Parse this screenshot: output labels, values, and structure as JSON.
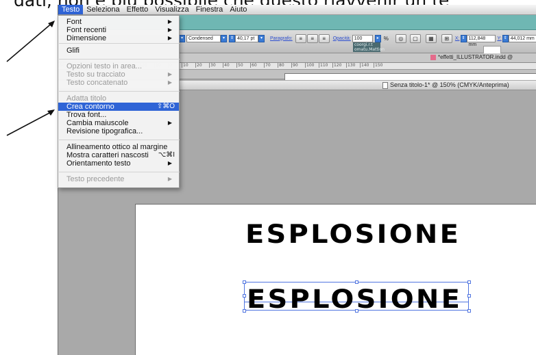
{
  "caption": "dati, non è più possibile che questo riavvenir un te",
  "menubar": {
    "items": [
      "Testo",
      "Seleziona",
      "Effetto",
      "Visualizza",
      "Finestra",
      "Aiuto"
    ],
    "active": "Testo"
  },
  "toolbar": {
    "font_style": "Condensed",
    "font_size": "40,17 pt",
    "paragraph_label": "Paragrafo:",
    "opacity_label": "Opacità:",
    "opacity_value": "100",
    "x_label": "X:",
    "x_value": "112,848 mm",
    "y_label": "Y:",
    "y_value": "44,012 mm",
    "l_label": "L:"
  },
  "panel_box_text": "coorgi.r.t omatu.Mattion",
  "indd_filename": "*effetti_ILLUSTRATOR.indd @",
  "document_title": "Senza titolo-1* @ 150% (CMYK/Anteprima)",
  "ruler_ticks": [
    "80",
    "90",
    "60",
    "50",
    "40",
    "30",
    "20",
    "10",
    "0",
    "10",
    "20",
    "30",
    "40",
    "50",
    "60",
    "70",
    "80",
    "90",
    "100",
    "110",
    "120",
    "130",
    "140",
    "150"
  ],
  "menu": {
    "items": [
      {
        "label": "Font",
        "submenu": true,
        "disabled": false
      },
      {
        "label": "Font recenti",
        "submenu": true,
        "disabled": false
      },
      {
        "label": "Dimensione",
        "submenu": true,
        "disabled": false
      },
      {
        "label": "Glifi",
        "submenu": false,
        "disabled": false
      },
      {
        "label": "Opzioni testo in area...",
        "submenu": false,
        "disabled": true
      },
      {
        "label": "Testo su tracciato",
        "submenu": true,
        "disabled": true
      },
      {
        "label": "Testo concatenato",
        "submenu": true,
        "disabled": true
      },
      {
        "label": "Adatta titolo",
        "submenu": false,
        "disabled": true
      },
      {
        "label": "Crea contorno",
        "shortcut": "⇧⌘O",
        "highlighted": true,
        "disabled": false
      },
      {
        "label": "Trova font...",
        "submenu": false,
        "disabled": false
      },
      {
        "label": "Cambia maiuscole",
        "submenu": true,
        "disabled": false
      },
      {
        "label": "Revisione tipografica...",
        "submenu": false,
        "disabled": false
      },
      {
        "label": "Allineamento ottico al margine",
        "submenu": false,
        "disabled": false
      },
      {
        "label": "Mostra caratteri nascosti",
        "shortcut": "⌥⌘I",
        "disabled": false
      },
      {
        "label": "Orientamento testo",
        "submenu": true,
        "disabled": false
      },
      {
        "label": "Testo precedente",
        "submenu": true,
        "disabled": true
      }
    ]
  },
  "artboard": {
    "headline_1": "ESPLOSIONE",
    "headline_2": "ESPLOSIONE"
  },
  "colors": {
    "menu_highlight": "#2f64d6",
    "teal_header": "#6fb7b3",
    "selection": "#4f74e0"
  }
}
